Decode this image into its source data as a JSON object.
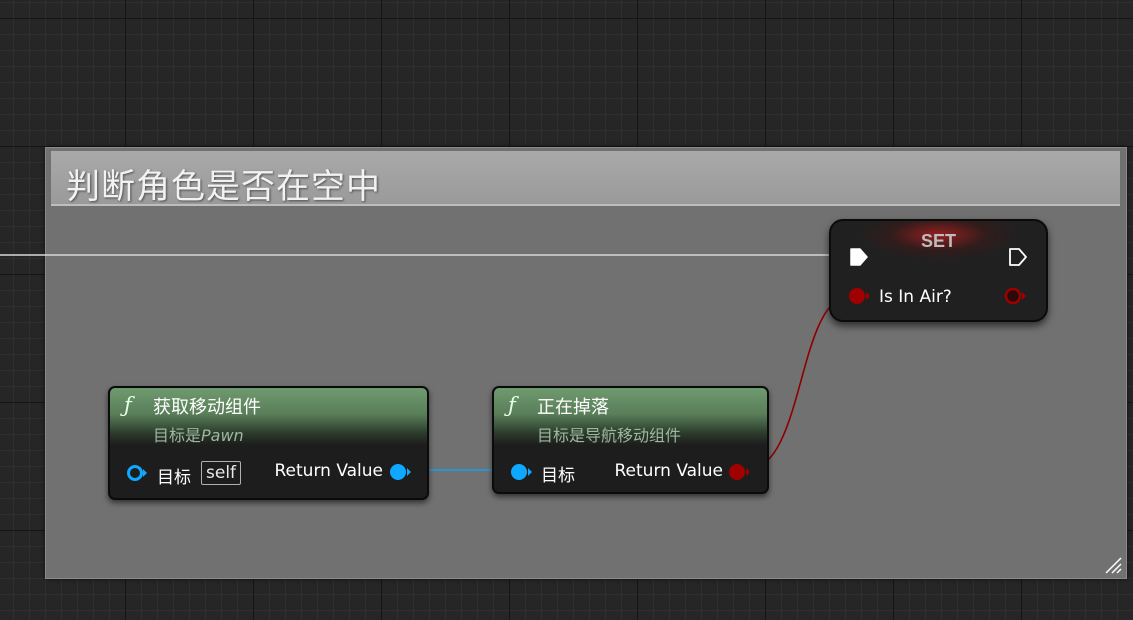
{
  "comment": {
    "title": "判断角色是否在空中"
  },
  "node_get_movement": {
    "icon": "function-icon",
    "title": "获取移动组件",
    "subtitle_prefix": "目标是",
    "subtitle_target": "Pawn",
    "input_label": "目标",
    "input_default": "self",
    "output_label": "Return Value"
  },
  "node_is_falling": {
    "icon": "function-icon",
    "title": "正在掉落",
    "subtitle": "目标是导航移动组件",
    "input_label": "目标",
    "output_label": "Return Value"
  },
  "node_set": {
    "title": "SET",
    "variable_label": "Is In Air?"
  },
  "colors": {
    "object_pin": "#0fa8ff",
    "bool_pin": "#a00000",
    "exec_pin": "#ffffff",
    "function_header": "#5a7f5a"
  }
}
